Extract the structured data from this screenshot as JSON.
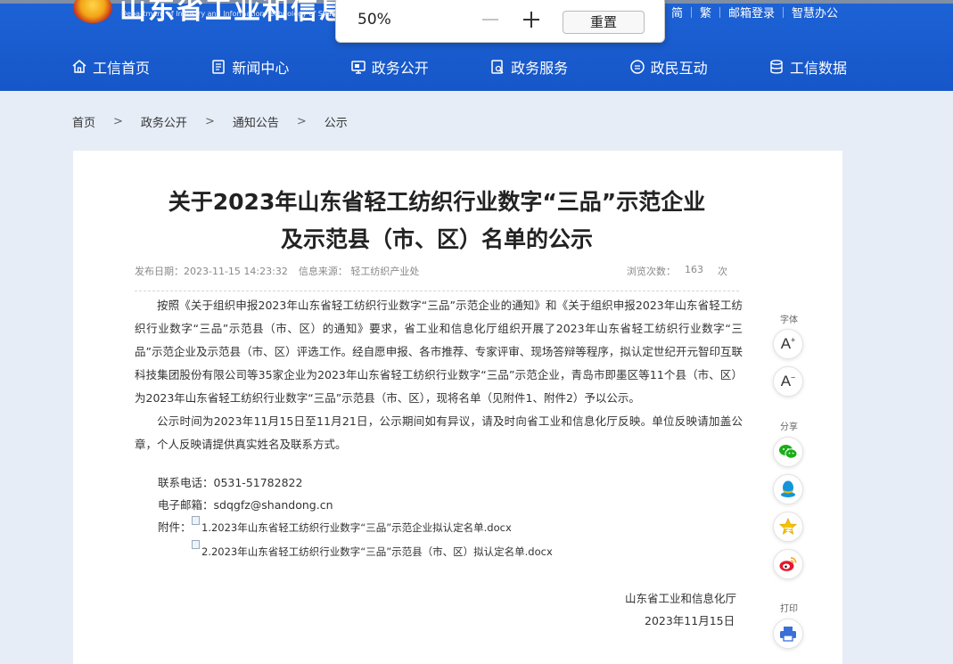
{
  "header": {
    "site_title": "山东省工业和信息化厅",
    "site_title_en": "Department of Industry and Information Technology of Shandong",
    "top_links": [
      "简",
      "繁",
      "邮箱登录",
      "智慧办公"
    ],
    "nav": [
      "工信首页",
      "新闻中心",
      "政务公开",
      "政务服务",
      "政民互动",
      "工信数据"
    ]
  },
  "zoom": {
    "percent": "50%",
    "reset_label": "重置"
  },
  "breadcrumb": {
    "items": [
      "首页",
      "政务公开",
      "通知公告",
      "公示"
    ],
    "separator": ">"
  },
  "article": {
    "title_line1": "关于2023年山东省轻工纺织行业数字“三品”示范企业",
    "title_line2": "及示范县（市、区）名单的公示",
    "date": "发布日期：2023-11-15 14:23:32",
    "source": "信息来源：  轻工纺织产业处",
    "views_label": "浏览次数：",
    "views_count": "163",
    "views_unit": "次",
    "paragraph1": "按照《关于组织申报2023年山东省轻工纺织行业数字“三品”示范企业的通知》和《关于组织申报2023年山东省轻工纺织行业数字“三品”示范县（市、区）的通知》要求，省工业和信息化厅组织开展了2023年山东省轻工纺织行业数字“三品”示范企业及示范县（市、区）评选工作。经自愿申报、各市推荐、专家评审、现场答辩等程序，拟认定世纪开元智印互联科技集团股份有限公司等35家企业为2023年山东省轻工纺织行业数字“三品”示范企业，青岛市即墨区等11个县（市、区）为2023年山东省轻工纺织行业数字“三品”示范县（市、区），现将名单（见附件1、附件2）予以公示。",
    "paragraph2": "公示时间为2023年11月15日至11月21日，公示期间如有异议，请及时向省工业和信息化厅反映。单位反映请加盖公章，个人反映请提供真实姓名及联系方式。",
    "phone": "联系电话：0531-51782822",
    "email": "电子邮箱：sdqgfz@shandong.cn",
    "attach_label": "附件：",
    "attachment1": "1.2023年山东省轻工纺织行业数字“三品”示范企业拟认定名单.docx",
    "attachment2": "2.2023年山东省轻工纺织行业数字“三品”示范县（市、区）拟认定名单.docx",
    "sign_org": "山东省工业和信息化厅",
    "sign_date": "2023年11月15日"
  },
  "side": {
    "font_label": "字体",
    "font_up": "A",
    "font_down": "A",
    "share_label": "分享",
    "print_label": "打印"
  },
  "colors": {
    "header_blue": "#1a5fd2",
    "page_bg": "#e6edf7",
    "wechat_green": "#1aad19",
    "qq_blue": "#1296db",
    "weibo_red": "#e6162d"
  }
}
